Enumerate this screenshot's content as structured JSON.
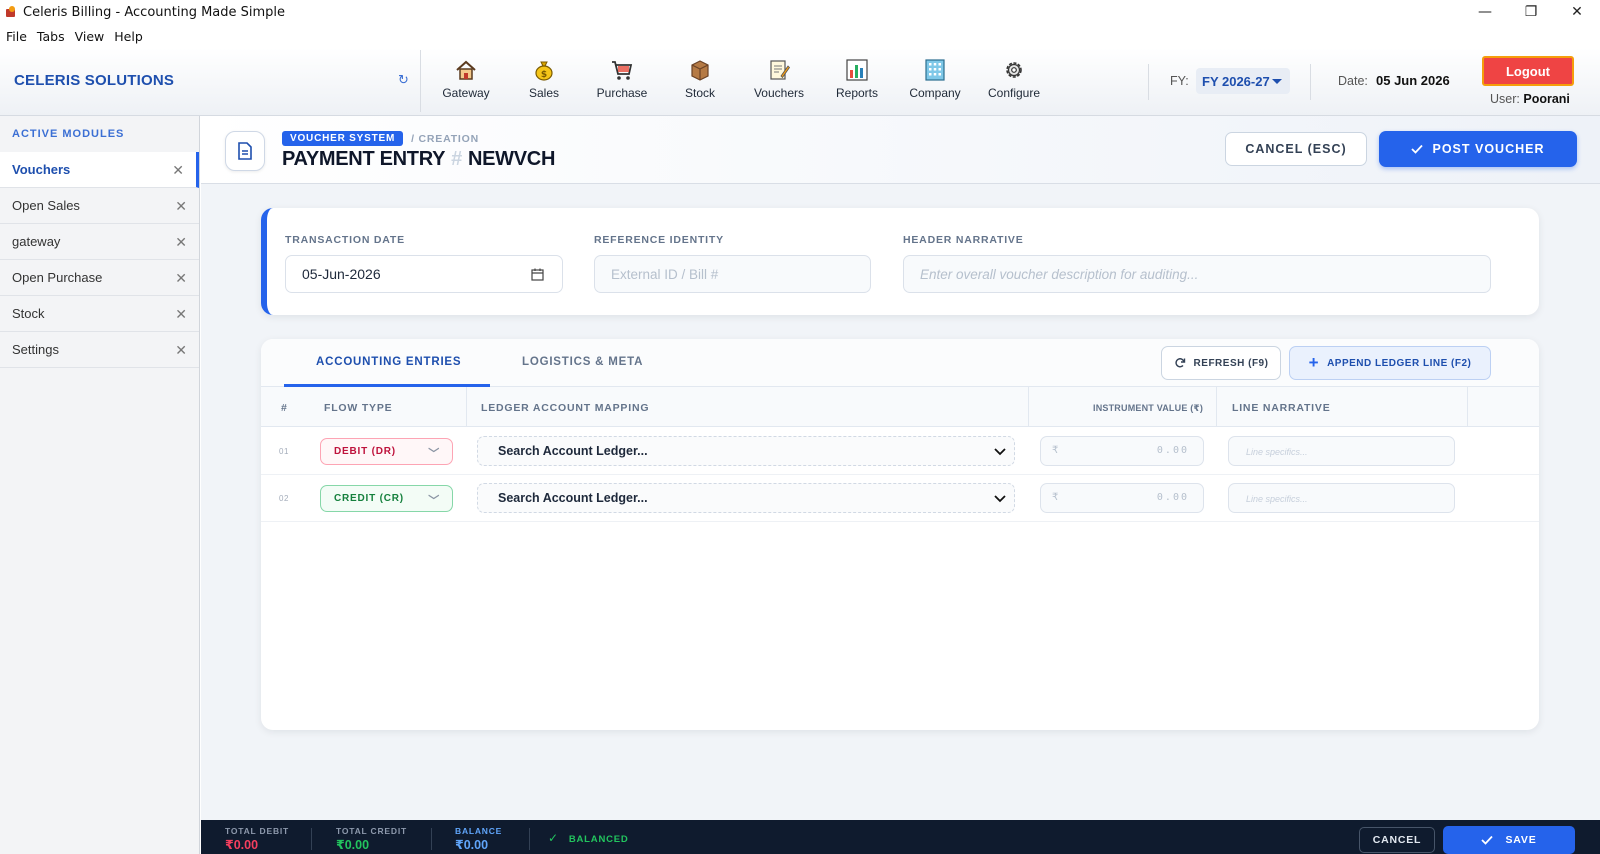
{
  "window": {
    "title": "Celeris Billing - Accounting Made Simple",
    "controls": {
      "minimize": "—",
      "restore": "❐",
      "close": "✕"
    }
  },
  "menu": [
    "File",
    "Tabs",
    "View",
    "Help"
  ],
  "header": {
    "brand": "CELERIS SOLUTIONS",
    "refresh_glyph": "↻",
    "nav": [
      {
        "label": "Gateway",
        "icon": "house-icon"
      },
      {
        "label": "Sales",
        "icon": "money-bag-icon"
      },
      {
        "label": "Purchase",
        "icon": "shopping-cart-icon"
      },
      {
        "label": "Stock",
        "icon": "box-icon"
      },
      {
        "label": "Vouchers",
        "icon": "memo-icon"
      },
      {
        "label": "Reports",
        "icon": "bar-chart-icon"
      },
      {
        "label": "Company",
        "icon": "building-icon"
      },
      {
        "label": "Configure",
        "icon": "gear-icon"
      }
    ],
    "fy_label": "FY:",
    "fy_value": "FY 2026-27",
    "date_label": "Date:",
    "date_value": "05 Jun 2026",
    "logout": "Logout",
    "user_label": "User:",
    "user_name": "Poorani"
  },
  "sidebar": {
    "heading": "ACTIVE MODULES",
    "close_glyph": "✕",
    "items": [
      {
        "label": "Vouchers",
        "active": true
      },
      {
        "label": "Open Sales",
        "active": false
      },
      {
        "label": "gateway",
        "active": false
      },
      {
        "label": "Open Purchase",
        "active": false
      },
      {
        "label": "Stock",
        "active": false
      },
      {
        "label": "Settings",
        "active": false
      }
    ]
  },
  "page": {
    "badge": "VOUCHER SYSTEM",
    "crumb": "/ CREATION",
    "title": "PAYMENT ENTRY",
    "hash": "#",
    "voucher_no": "NEWVCH",
    "cancel_btn": "CANCEL (ESC)",
    "post_btn": "POST VOUCHER"
  },
  "form": {
    "date_label": "TRANSACTION DATE",
    "date_value": "05-Jun-2026",
    "ref_label": "REFERENCE IDENTITY",
    "ref_placeholder": "External ID / Bill #",
    "narr_label": "HEADER NARRATIVE",
    "narr_placeholder": "Enter overall voucher description for auditing..."
  },
  "entries": {
    "tabs": [
      "ACCOUNTING ENTRIES",
      "LOGISTICS & META"
    ],
    "refresh_btn": "REFRESH (F9)",
    "append_btn": "APPEND LEDGER LINE (F2)",
    "columns": [
      "#",
      "FLOW TYPE",
      "LEDGER ACCOUNT MAPPING",
      "INSTRUMENT VALUE (₹)",
      "LINE NARRATIVE"
    ],
    "rows": [
      {
        "num": "01",
        "flow": "DEBIT (DR)",
        "ledger": "Search Account Ledger...",
        "currency": "₹",
        "amount": "0.00",
        "narrative": "Line specifics..."
      },
      {
        "num": "02",
        "flow": "CREDIT (CR)",
        "ledger": "Search Account Ledger...",
        "currency": "₹",
        "amount": "0.00",
        "narrative": "Line specifics..."
      }
    ]
  },
  "footer": {
    "total_debit_label": "TOTAL DEBIT",
    "total_debit": "₹0.00",
    "total_credit_label": "TOTAL CREDIT",
    "total_credit": "₹0.00",
    "balance_label": "BALANCE",
    "balance": "₹0.00",
    "status": "BALANCED",
    "cancel": "CANCEL",
    "save": "SAVE"
  },
  "colors": {
    "accent": "#2563eb",
    "debit": "#be123c",
    "credit": "#15803d",
    "logout": "#ef4444",
    "footer_bg": "#0f1b2e"
  }
}
